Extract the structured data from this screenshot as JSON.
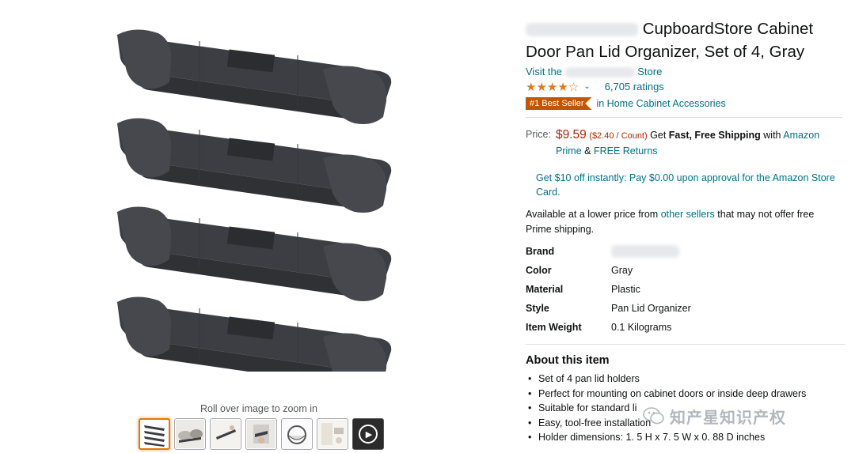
{
  "gallery": {
    "zoom_hint": "Roll over image to zoom in",
    "thumbnails": [
      "thumbnail-product-set",
      "thumbnail-in-use",
      "thumbnail-mounting",
      "thumbnail-detail",
      "thumbnail-round-item",
      "thumbnail-kitchen",
      "thumbnail-video"
    ]
  },
  "product": {
    "title_visible": "CupboardStore Cabinet Door Pan Lid Organizer, Set of 4, Gray",
    "store_visit_prefix": "Visit the",
    "store_visit_suffix": "Store",
    "stars_text": "★★★★☆",
    "rating_value": 4.3,
    "ratings_count": "6,705 ratings",
    "badge": "#1 Best Seller",
    "badge_category": "in Home Cabinet Accessories"
  },
  "price": {
    "label": "Price:",
    "amount": "$9.59",
    "unit_price": "($2.40 / Count)",
    "shipping_pre": "Get",
    "shipping_bold": "Fast, Free Shipping",
    "shipping_with": "with",
    "prime_link": "Amazon Prime",
    "amp": "&",
    "returns_link": "FREE Returns"
  },
  "promo": {
    "text": "Get $10 off instantly: Pay $0.00 upon approval for the Amazon Store Card."
  },
  "lower_price": {
    "pre": "Available at a lower price from",
    "link": "other sellers",
    "post": "that may not offer free Prime shipping."
  },
  "specs": [
    {
      "key": "Brand",
      "value": ""
    },
    {
      "key": "Color",
      "value": "Gray"
    },
    {
      "key": "Material",
      "value": "Plastic"
    },
    {
      "key": "Style",
      "value": "Pan Lid Organizer"
    },
    {
      "key": "Item Weight",
      "value": "0.1 Kilograms"
    }
  ],
  "about": {
    "title": "About this item",
    "bullets": [
      "Set of 4 pan lid holders",
      "Perfect for mounting on cabinet doors or inside deep drawers",
      "Suitable for standard li",
      "Easy, tool-free installation",
      "Holder dimensions: 1. 5 H x 7. 5 W x 0. 88 D inches"
    ]
  },
  "watermark": {
    "text": "知产星知识产权"
  },
  "colors": {
    "link": "#007185",
    "price": "#b12704",
    "badge": "#c45500",
    "stars": "#de7921",
    "product_gray": "#3c3e43"
  }
}
